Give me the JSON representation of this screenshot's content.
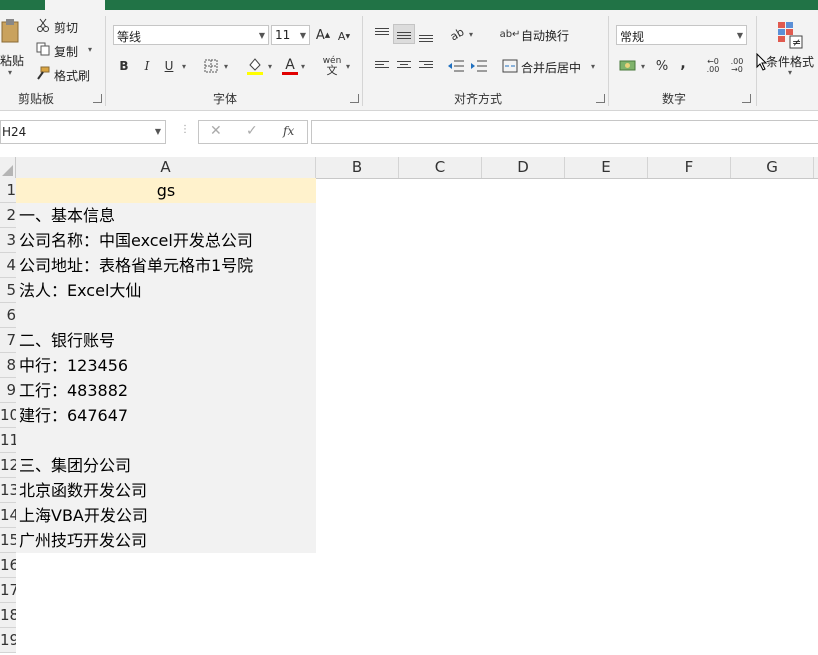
{
  "ribbon": {
    "clipboard": {
      "paste": "粘贴",
      "cut": "剪切",
      "copy": "复制",
      "format_painter": "格式刷",
      "label": "剪贴板"
    },
    "font": {
      "name": "等线",
      "size": "11",
      "bold": "B",
      "italic": "I",
      "underline": "U",
      "label": "字体"
    },
    "alignment": {
      "wrap_text": "自动换行",
      "merge_center": "合并后居中",
      "label": "对齐方式"
    },
    "number": {
      "format": "常规",
      "percent": "%",
      "comma": ",",
      "label": "数字"
    },
    "styles": {
      "conditional_formatting": "条件格式"
    }
  },
  "formula_bar": {
    "name_box": "H24",
    "fx": "fx",
    "content": ""
  },
  "columns": [
    "A",
    "B",
    "C",
    "D",
    "E",
    "F",
    "G"
  ],
  "rows": [
    {
      "num": "1",
      "a": "gs",
      "header": true
    },
    {
      "num": "2",
      "a": "一、基本信息"
    },
    {
      "num": "3",
      "a": "公司名称：中国excel开发总公司"
    },
    {
      "num": "4",
      "a": "公司地址：表格省单元格市1号院"
    },
    {
      "num": "5",
      "a": "法人：Excel大仙"
    },
    {
      "num": "6",
      "a": ""
    },
    {
      "num": "7",
      "a": "二、银行账号"
    },
    {
      "num": "8",
      "a": "中行：123456"
    },
    {
      "num": "9",
      "a": "工行：483882"
    },
    {
      "num": "10",
      "a": "建行：647647"
    },
    {
      "num": "11",
      "a": ""
    },
    {
      "num": "12",
      "a": "三、集团分公司"
    },
    {
      "num": "13",
      "a": "北京函数开发公司"
    },
    {
      "num": "14",
      "a": "上海VBA开发公司"
    },
    {
      "num": "15",
      "a": "广州技巧开发公司"
    },
    {
      "num": "16",
      "a": ""
    },
    {
      "num": "17",
      "a": ""
    },
    {
      "num": "18",
      "a": ""
    },
    {
      "num": "19",
      "a": ""
    }
  ],
  "colors": {
    "tab_bar": "#217346",
    "header_cell": "#fff2cc",
    "font_color": "#e00000"
  }
}
